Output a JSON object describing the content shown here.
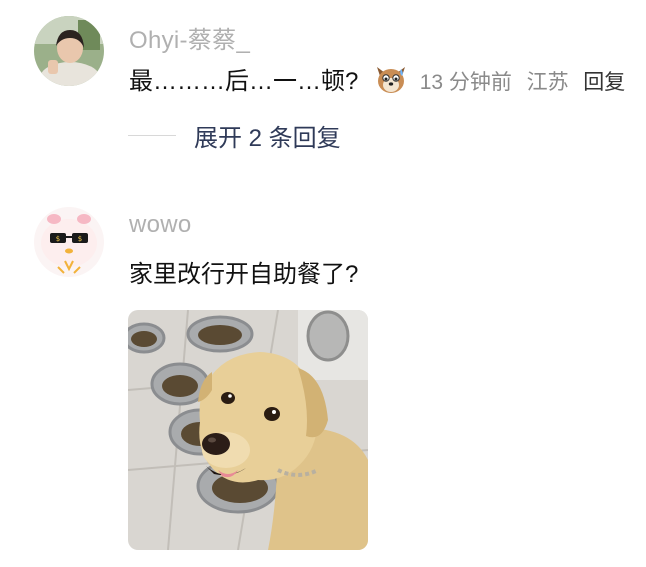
{
  "comments": [
    {
      "username": "Ohyi-蔡蔡_",
      "text": "最………后…一…顿?",
      "emoji_icon": "dog-face-sweat-icon",
      "time": "13 分钟前",
      "location": "江苏",
      "reply_label": "回复",
      "expand_label": "展开 2 条回复"
    },
    {
      "username": "wowo",
      "text": "家里改行开自助餐了?",
      "image": "dog-with-food-bowls-photo"
    }
  ],
  "colors": {
    "username": "#b0b0b0",
    "text": "#111111",
    "meta": "#8a8a8a",
    "expand": "#2f3a58"
  }
}
